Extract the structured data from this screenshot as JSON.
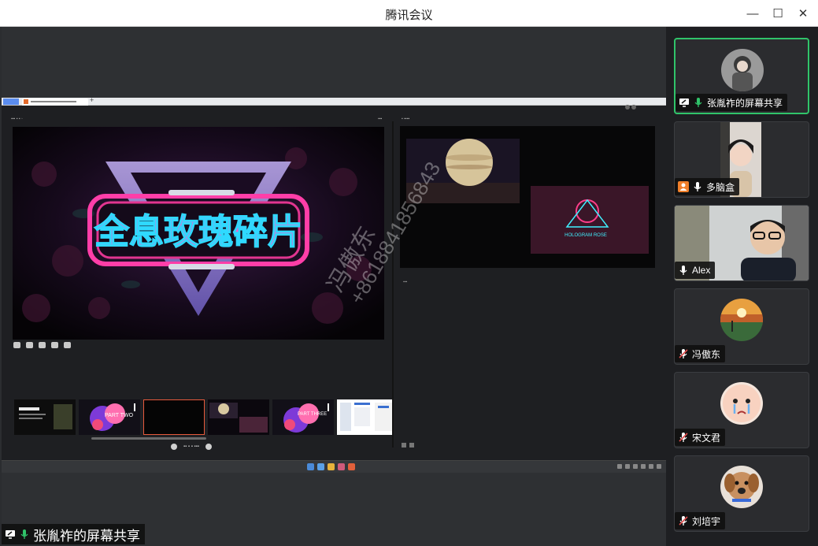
{
  "window": {
    "title": "腾讯会议",
    "minimize_glyph": "—",
    "maximize_glyph": "☐",
    "close_glyph": "✕"
  },
  "shared_screen": {
    "slide_title": "全息玫瑰碎片",
    "thumb2_text": "PART TWO",
    "thumb5_text": "PART THREE",
    "right_slide_text": "HOLOGRAM ROSE",
    "watermark_name": "冯傲东",
    "watermark_phone": "+8618841856843",
    "selected_thumbnail": 3
  },
  "share_label": {
    "text": "张胤祚的屏幕共享",
    "icons": [
      "screen-share-icon",
      "mic-on-icon"
    ]
  },
  "participants": [
    {
      "name": "张胤祚的屏幕共享",
      "mic": "on",
      "badge": "screen-share-icon",
      "active": true
    },
    {
      "name": "多脑盒",
      "mic": "on",
      "badge": "host-icon",
      "active": false
    },
    {
      "name": "Alex",
      "mic": "on",
      "badge": "",
      "active": false
    },
    {
      "name": "冯傲东",
      "mic": "muted",
      "badge": "",
      "active": false
    },
    {
      "name": "宋文君",
      "mic": "muted",
      "badge": "",
      "active": false
    },
    {
      "name": "刘培宇",
      "mic": "muted",
      "badge": "",
      "active": false
    }
  ],
  "colors": {
    "active_border": "#30c46a",
    "mic_on": "#30c46a",
    "mic_muted": "#e04b4b",
    "host_badge": "#f07f2a",
    "thumb_selected": "#e65a3c"
  }
}
